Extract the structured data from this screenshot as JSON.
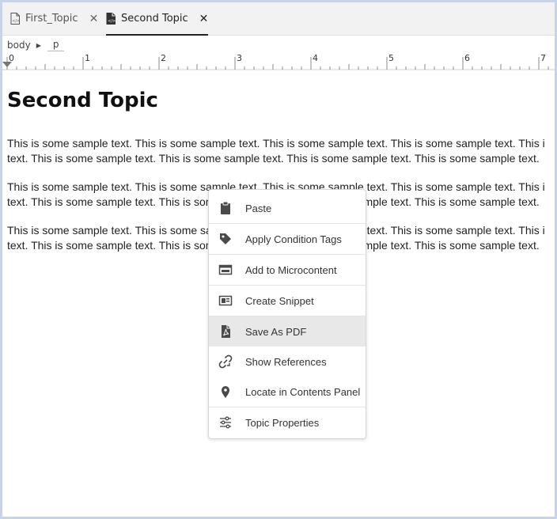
{
  "tabs": [
    {
      "label": "First_Topic",
      "active": false,
      "close": "✕"
    },
    {
      "label": "Second Topic",
      "active": true,
      "close": "✕"
    }
  ],
  "breadcrumb": {
    "root": "body",
    "separator": "▶",
    "current": "p"
  },
  "ruler": {
    "labels": [
      "0",
      "1",
      "2",
      "3",
      "4",
      "5",
      "6",
      "7"
    ]
  },
  "document": {
    "title": "Second Topic",
    "paragraphs": [
      {
        "line1": "This is some sample text. This is some sample text. This is some sample text. This is some sample text. This i",
        "line2": "text. This is some sample text. This is some sample text. This is some sample text. This is some sample text."
      },
      {
        "line1": "This is some sample text. This is some sample text. This is some sample text. This is some sample text. This i",
        "line2": "text. This is some sample text. This is some sample text. This is some sample text. This is some sample text."
      },
      {
        "line1": "This is some sample text. This is some sample text. This is some sample text. This is some sample text. This i",
        "line2": "text. This is some sample text. This is some sample text. This is some sample text. This is some sample text."
      }
    ]
  },
  "context_menu": {
    "items": [
      {
        "label": "Paste",
        "icon": "clipboard-icon"
      },
      {
        "label": "Apply Condition Tags",
        "icon": "tag-icon"
      },
      {
        "label": "Add to Microcontent",
        "icon": "microcontent-icon"
      },
      {
        "label": "Create Snippet",
        "icon": "snippet-icon"
      },
      {
        "label": "Save As PDF",
        "icon": "pdf-icon",
        "highlighted": true
      },
      {
        "label": "Show References",
        "icon": "link-icon"
      },
      {
        "label": "Locate in Contents Panel",
        "icon": "location-pin-icon"
      },
      {
        "label": "Topic Properties",
        "icon": "sliders-icon"
      }
    ]
  },
  "colors": {
    "highlight": "#e8e8e8",
    "frame": "#c7d3e6",
    "tabbar": "#f2f2f2"
  }
}
